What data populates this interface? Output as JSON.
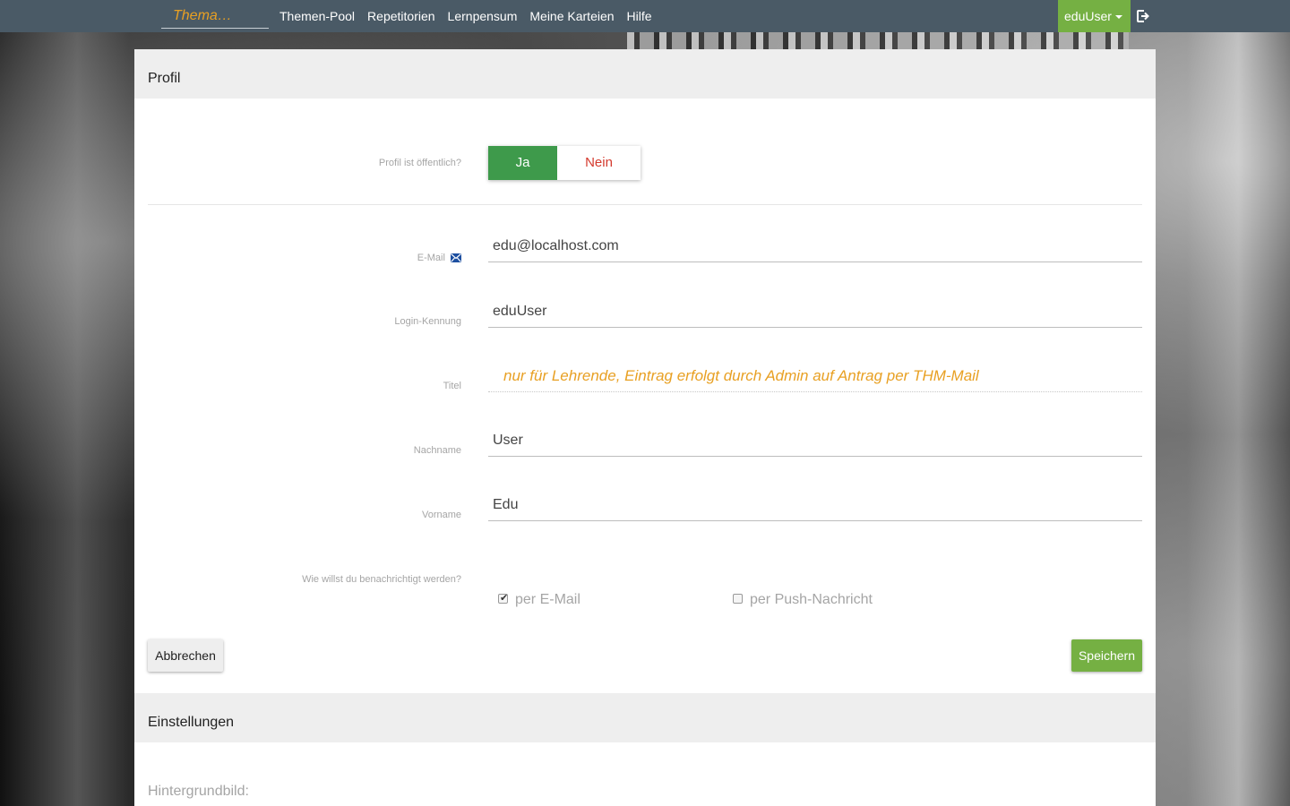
{
  "navbar": {
    "brand": "Thema…",
    "links": [
      "Themen-Pool",
      "Repetitorien",
      "Lernpensum",
      "Meine Karteien",
      "Hilfe"
    ],
    "user": "eduUser",
    "accent_color": "#75b043",
    "bar_color": "#4a5a66"
  },
  "profile": {
    "heading": "Profil",
    "public_label": "Profil ist öffentlich?",
    "public_yes": "Ja",
    "public_no": "Nein",
    "public_selected": "Ja",
    "email_label": "E-Mail",
    "email_value": "edu@localhost.com",
    "login_label": "Login-Kennung",
    "login_value": "eduUser",
    "title_label": "Titel",
    "title_note": "nur für Lehrende, Eintrag erfolgt durch Admin auf Antrag per THM-Mail",
    "lastname_label": "Nachname",
    "lastname_value": "User",
    "firstname_label": "Vorname",
    "firstname_value": "Edu",
    "notify_label": "Wie willst du benachrichtigt werden?",
    "notify_email": "per E-Mail",
    "notify_email_checked": true,
    "notify_push": "per Push-Nachricht",
    "notify_push_checked": false,
    "cancel_label": "Abbrechen",
    "save_label": "Speichern"
  },
  "settings": {
    "heading": "Einstellungen",
    "background_label": "Hintergrundbild:"
  }
}
